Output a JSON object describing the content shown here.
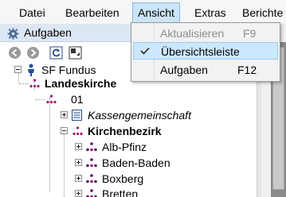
{
  "menubar": {
    "items": [
      {
        "label": "Datei"
      },
      {
        "label": "Bearbeiten"
      },
      {
        "label": "Ansicht",
        "active": true
      },
      {
        "label": "Extras"
      },
      {
        "label": "Berichte"
      }
    ]
  },
  "pane": {
    "title": "Aufgaben",
    "toolbar": {
      "buttons": [
        "back",
        "forward",
        "refresh",
        "layout"
      ]
    }
  },
  "tree": {
    "nodes": [
      {
        "label": "SF Fundus",
        "style": "normal",
        "expander": "minus",
        "icon": "root-person-icon"
      },
      {
        "label": "Landeskirche",
        "style": "bold",
        "expander": "none",
        "icon": "org-node-icon"
      },
      {
        "label": "01",
        "style": "normal",
        "expander": "none",
        "icon": "org-node-icon"
      },
      {
        "label": "Kassengemeinschaft",
        "style": "italic",
        "expander": "plus",
        "icon": "document-icon"
      },
      {
        "label": "Kirchenbezirk",
        "style": "bold",
        "expander": "minus",
        "icon": "org-node-icon"
      },
      {
        "label": "Alb-Pfinz",
        "style": "normal",
        "expander": "plus",
        "icon": "group-icon"
      },
      {
        "label": "Baden-Baden",
        "style": "normal",
        "expander": "plus",
        "icon": "group-icon"
      },
      {
        "label": "Boxberg",
        "style": "normal",
        "expander": "plus",
        "icon": "group-icon"
      },
      {
        "label": "Bretten",
        "style": "normal",
        "expander": "plus",
        "icon": "group-icon"
      }
    ]
  },
  "dropdown": {
    "items": [
      {
        "label": "Aktualisieren",
        "shortcut": "F9",
        "disabled": true,
        "checked": false,
        "highlighted": false
      },
      {
        "label": "Übersichtsleiste",
        "shortcut": "",
        "disabled": false,
        "checked": true,
        "highlighted": true
      },
      {
        "label": "Aufgaben",
        "shortcut": "F12",
        "disabled": false,
        "checked": false,
        "highlighted": false
      }
    ]
  },
  "colors": {
    "menu_active_bg": "#cce4f7",
    "pane_header_bg": "#dce7f4",
    "highlight_bg": "#cce8ff",
    "disabled_text": "#8d8d8d",
    "icon_magenta": "#a1187a",
    "icon_dark_magenta": "#5a1a5a"
  }
}
